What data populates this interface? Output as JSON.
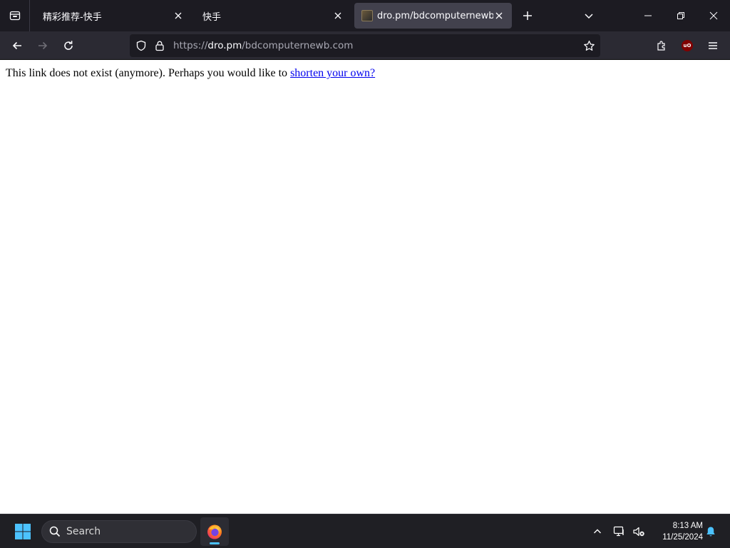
{
  "browser": {
    "tabs": [
      {
        "label": "精彩推荐-快手",
        "active": false
      },
      {
        "label": "快手",
        "active": false
      },
      {
        "label": "dro.pm/bdcomputernewb.com",
        "active": true
      }
    ],
    "address": {
      "scheme": "https://",
      "host": "dro.pm",
      "path": "/bdcomputernewb.com"
    },
    "extension_badge": "uO"
  },
  "page": {
    "message_text": "This link does not exist (anymore). Perhaps you would like to ",
    "link_text": "shorten your own?"
  },
  "taskbar": {
    "search_label": "Search",
    "time": "8:13 AM",
    "date": "11/25/2024"
  },
  "colors": {
    "tabbar_bg": "#1c1b22",
    "navbar_bg": "#2b2a33",
    "active_tab_bg": "#42414d",
    "link": "#0000ee",
    "taskbar_bg": "#1f1f24",
    "accent": "#4cc2ff"
  }
}
